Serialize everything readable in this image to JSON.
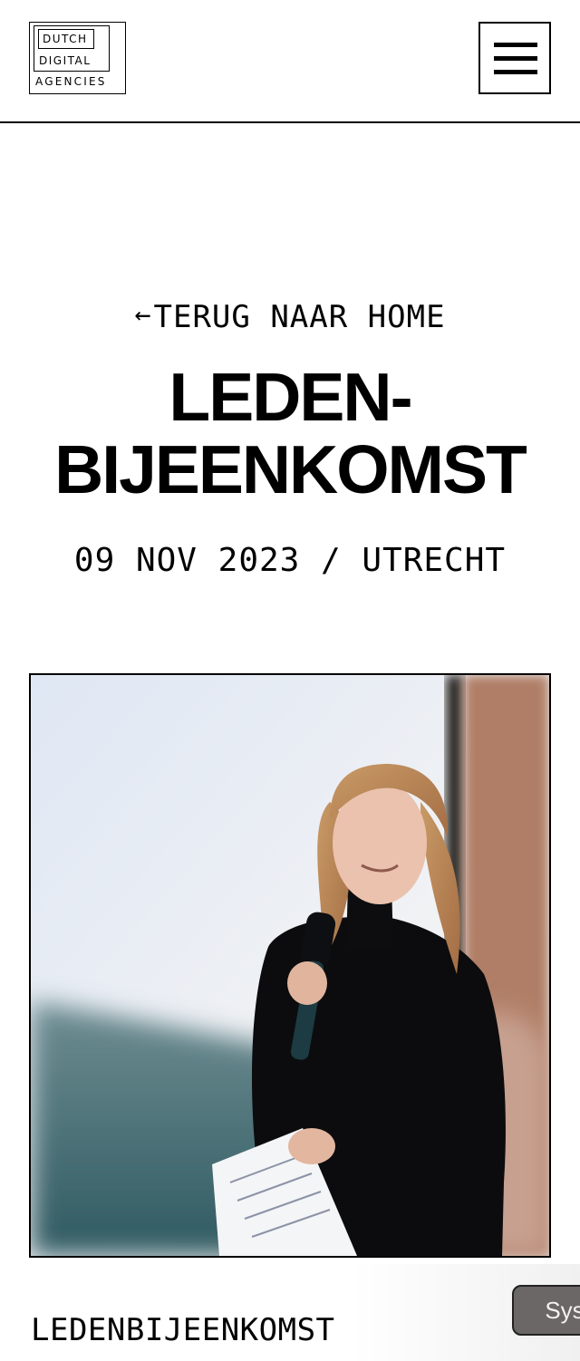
{
  "header": {
    "logo": {
      "line1": "DUTCH",
      "line2": "DIGITAL",
      "line3": "AGENCIES"
    },
    "menu_icon": "hamburger-menu-icon"
  },
  "hero": {
    "back_arrow_icon": "arrow-left-icon",
    "back_label": "TERUG NAAR HOME",
    "title_line1": "LEDEN-",
    "title_line2": "BIJEENKOMST",
    "meta": "09 NOV 2023 / UTRECHT"
  },
  "photo": {
    "subject": "woman-speaking-with-microphone"
  },
  "section": {
    "label": "LEDENBIJEENKOMST"
  },
  "floating": {
    "sys_label": "Sys"
  },
  "colors": {
    "text": "#000000",
    "background": "#ffffff",
    "pill": "#6b6766"
  }
}
